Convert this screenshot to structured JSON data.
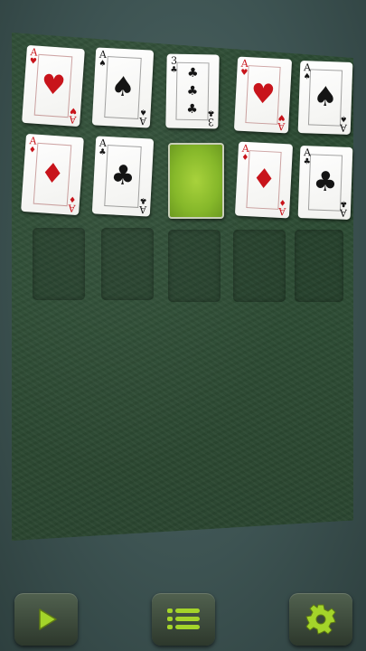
{
  "game": {
    "name": "solitaire",
    "colors": {
      "felt": "#2b4a32",
      "card_back": "#8fc22e",
      "accent": "#a4d42a",
      "red_suit": "#c8141b",
      "black_suit": "#141414"
    },
    "row1": [
      {
        "rank": "A",
        "suit": "♥",
        "color": "red"
      },
      {
        "rank": "A",
        "suit": "♠",
        "color": "black"
      },
      {
        "rank": "3",
        "suit": "♣",
        "color": "black"
      },
      {
        "rank": "A",
        "suit": "♥",
        "color": "red"
      },
      {
        "rank": "A",
        "suit": "♠",
        "color": "black"
      }
    ],
    "row2": [
      {
        "rank": "A",
        "suit": "♦",
        "color": "red"
      },
      {
        "rank": "A",
        "suit": "♣",
        "color": "black"
      },
      {
        "face_down": true
      },
      {
        "rank": "A",
        "suit": "♦",
        "color": "red"
      },
      {
        "rank": "A",
        "suit": "♣",
        "color": "black"
      }
    ],
    "empty_slots": 5
  },
  "toolbar": {
    "play_icon": "play-icon",
    "menu_icon": "menu-list-icon",
    "settings_icon": "gear-icon"
  }
}
